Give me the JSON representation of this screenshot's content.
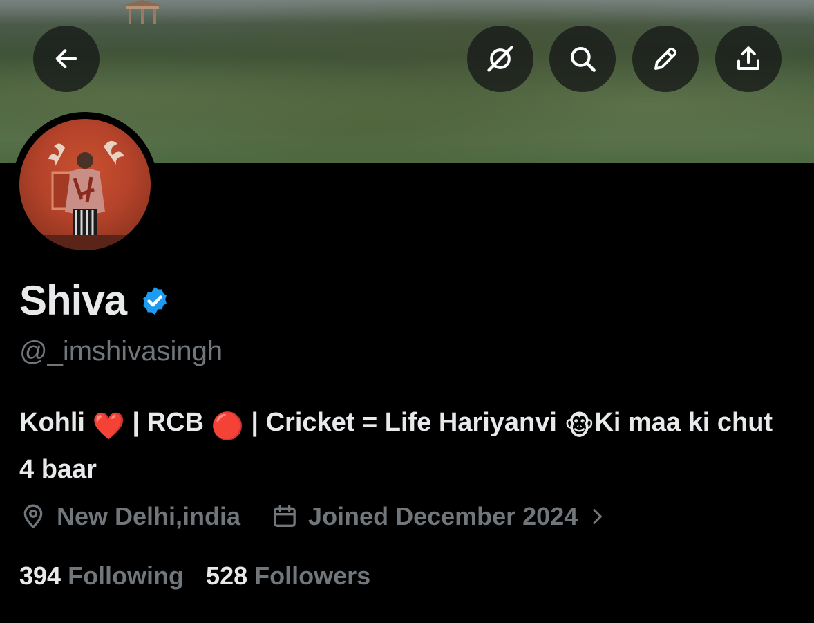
{
  "toolbar": {
    "back_icon": "arrow-left-icon",
    "grok_icon": "grok-icon",
    "search_icon": "search-icon",
    "edit_icon": "pencil-icon",
    "share_icon": "share-icon"
  },
  "profile": {
    "name": "Shiva",
    "verified_color": "#1d9bf0",
    "handle": "@_imshivasingh",
    "bio": {
      "part1": "Kohli ",
      "emoji_heart": "❤️",
      "part2": " | RCB ",
      "emoji_red_circle": "🔴",
      "part3": " | Cricket = Life Hariyanvi ",
      "emoji_monkey": "🐵",
      "part4": "Ki maa ki chut 4 baar"
    },
    "location": "New Delhi,india",
    "joined": "Joined December 2024",
    "following_count": "394",
    "following_label": "Following",
    "followers_count": "528",
    "followers_label": "Followers"
  },
  "colors": {
    "background": "#000000",
    "text_primary": "#e7e9ea",
    "text_secondary": "#71767b",
    "accent": "#1d9bf0"
  }
}
